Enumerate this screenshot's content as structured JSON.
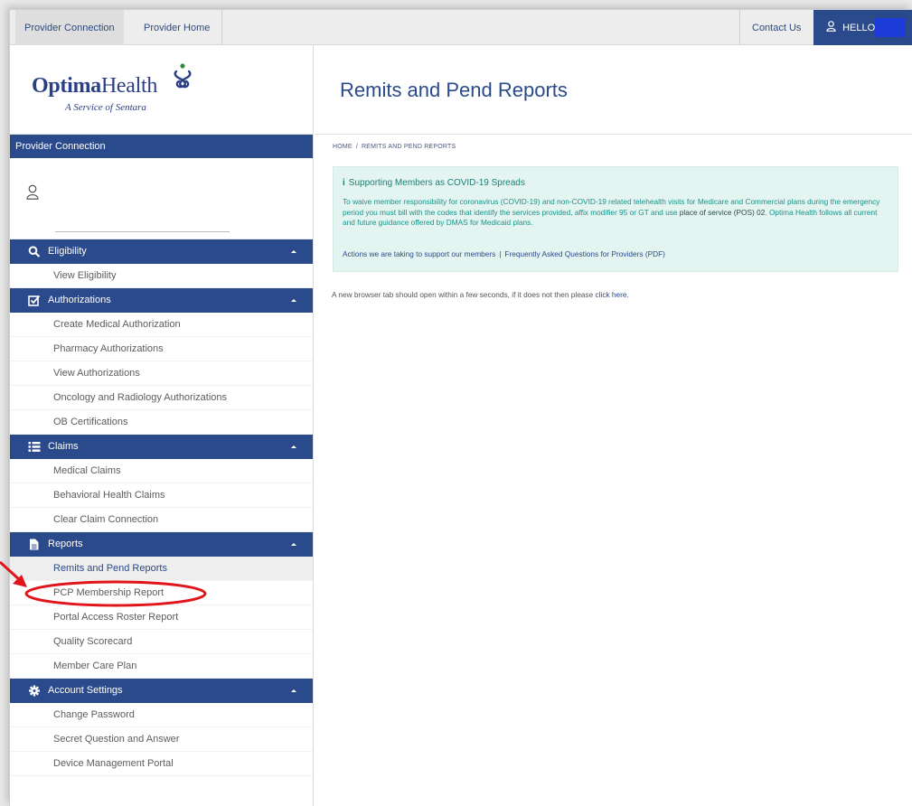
{
  "topbar": {
    "tab_provider_connection": "Provider Connection",
    "tab_provider_home": "Provider Home",
    "contact_us": "Contact Us",
    "hello": "HELLO"
  },
  "logo": {
    "brand_bold": "Optima",
    "brand_light": "Health",
    "tagline": "A Service of Sentara"
  },
  "sidebar": {
    "header": "Provider Connection",
    "sections": [
      {
        "label": "Eligibility",
        "items": [
          "View Eligibility"
        ]
      },
      {
        "label": "Authorizations",
        "items": [
          "Create Medical Authorization",
          "Pharmacy Authorizations",
          "View Authorizations",
          "Oncology and Radiology Authorizations",
          "OB Certifications"
        ]
      },
      {
        "label": "Claims",
        "items": [
          "Medical Claims",
          "Behavioral Health Claims",
          "Clear Claim Connection"
        ]
      },
      {
        "label": "Reports",
        "items": [
          "Remits and Pend Reports",
          "PCP Membership Report",
          "Portal Access Roster Report",
          "Quality Scorecard",
          "Member Care Plan"
        ]
      },
      {
        "label": "Account Settings",
        "items": [
          "Change Password",
          "Secret Question and Answer",
          "Device Management Portal"
        ]
      }
    ]
  },
  "main": {
    "title": "Remits and Pend Reports",
    "breadcrumb_home": "HOME",
    "breadcrumb_sep": "/",
    "breadcrumb_current": "REMITS AND PEND REPORTS",
    "notice": {
      "title": "Supporting Members as COVID-19 Spreads",
      "body_part1": "To waive member responsibility for coronavirus (COVID-19) and non-COVID-19 related telehealth visits for Medicare and Commercial plans during the emergency period you must bill with the codes that identify the services provided, affix modifier 95 or GT and use ",
      "body_bold": "place of service (POS) 02",
      "body_part2": ". Optima Health follows all current and future guidance offered by DMAS for Medicaid plans.",
      "link_actions": "Actions we are taking to support our members",
      "link_sep": "|",
      "link_faq": "Frequently Asked Questions for Providers (PDF)"
    },
    "newtab_text": "A new browser tab should open within a few seconds, if it does not then please ",
    "newtab_link": "click here."
  },
  "colors": {
    "brand_navy": "#2b4a8b",
    "notice_bg": "#e4f5f1",
    "notice_text": "#17938a",
    "annotation_red": "#e0141a"
  }
}
